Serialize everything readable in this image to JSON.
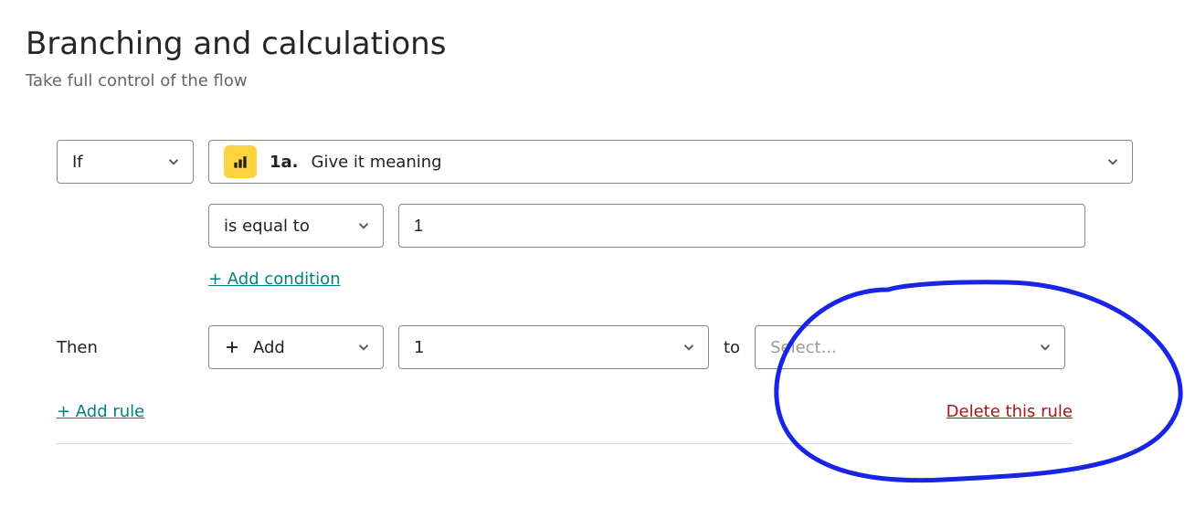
{
  "header": {
    "title": "Branching and calculations",
    "subtitle": "Take full control of the flow"
  },
  "rule": {
    "if_label": "If",
    "question_number": "1a.",
    "question_text": "Give it meaning",
    "comparator": "is equal to",
    "compare_value": "1",
    "add_condition": "+ Add condition",
    "then_label": "Then",
    "action": "Add",
    "action_value": "1",
    "to_word": "to",
    "destination_placeholder": "Select...",
    "add_rule": "+ Add rule",
    "delete_rule": "Delete this rule"
  }
}
